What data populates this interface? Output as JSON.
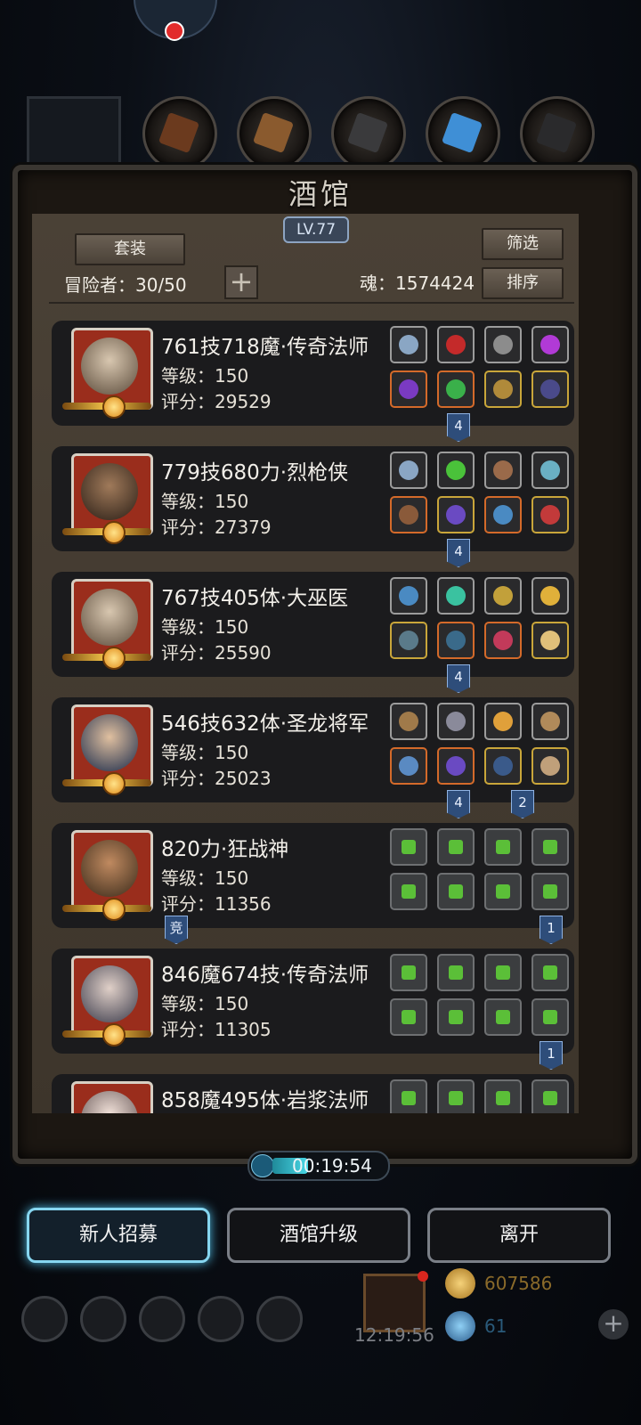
{
  "header": {
    "title": "酒馆",
    "level": "LV.77"
  },
  "buttons": {
    "set": "套装",
    "filter": "筛选",
    "sort": "排序"
  },
  "stats": {
    "adventurers": "冒险者：30/50",
    "soul": "魂：1574424"
  },
  "heroes": [
    {
      "name": "761技718魔·传奇法师",
      "level": "等级：150",
      "score": "评分：29529"
    },
    {
      "name": "779技680力·烈枪侠",
      "level": "等级：150",
      "score": "评分：27379"
    },
    {
      "name": "767技405体·大巫医",
      "level": "等级：150",
      "score": "评分：25590"
    },
    {
      "name": "546技632体·圣龙将军",
      "level": "等级：150",
      "score": "评分：25023"
    },
    {
      "name": "820力·狂战神",
      "level": "等级：150",
      "score": "评分：11356"
    },
    {
      "name": "846魔674技·传奇法师",
      "level": "等级：150",
      "score": "评分：11305"
    },
    {
      "name": "858魔495体·岩浆法师",
      "level": "",
      "score": ""
    }
  ],
  "badges": {
    "b1": "4",
    "b2": "4",
    "b3": "4",
    "b4a": "4",
    "b4b": "2",
    "b5a": "竞",
    "b5b": "1",
    "b6": "1"
  },
  "timer": "00:19:54",
  "actions": {
    "recruit": "新人招募",
    "upgrade": "酒馆升级",
    "leave": "离开"
  },
  "footer": {
    "clock": "12:19:56",
    "gold": "607586",
    "gems": "61"
  },
  "colors": {
    "accent": "#86d6f0",
    "gold": "#c9a63a",
    "orange": "#d46a2a"
  }
}
